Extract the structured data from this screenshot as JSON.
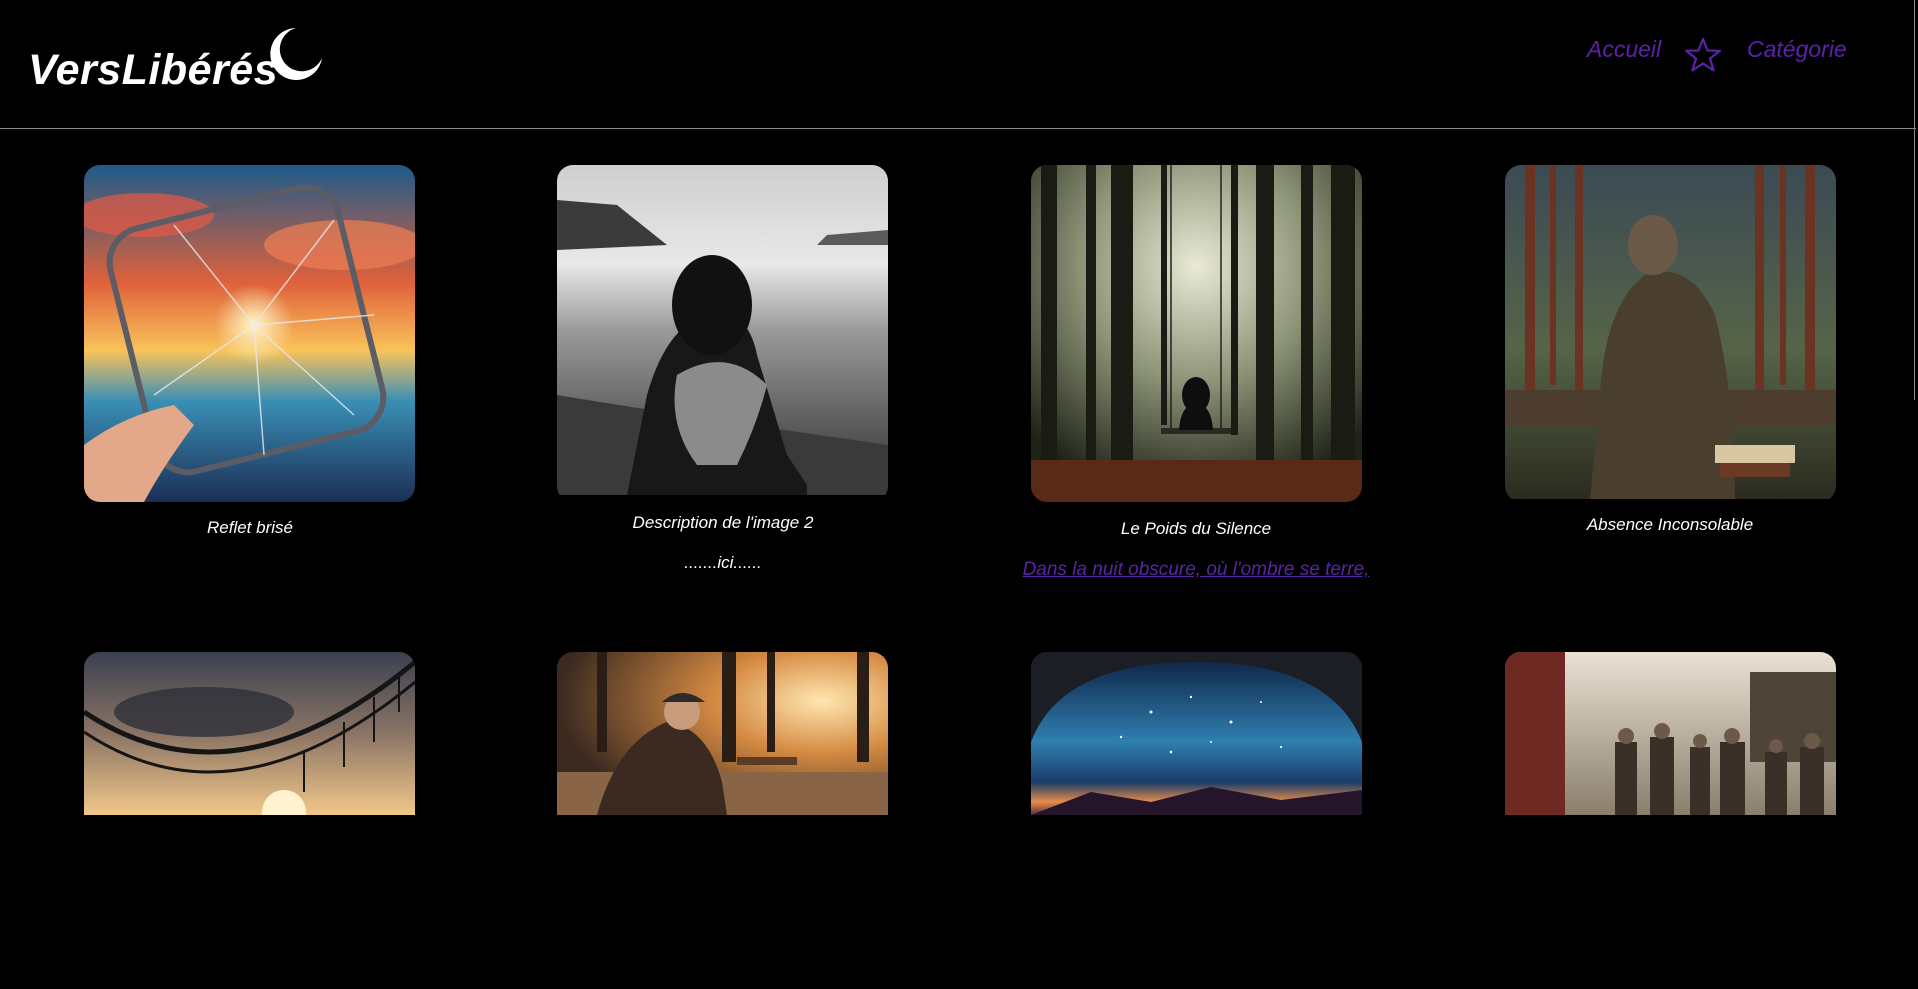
{
  "brand": {
    "name": "VersLibérés",
    "icon": "crescent-moon-icon"
  },
  "nav": {
    "home_label": "Accueil",
    "category_label": "Catégorie",
    "separator_icon": "star-icon",
    "link_color": "#5b23a8"
  },
  "gallery": {
    "row1": [
      {
        "caption": "Reflet brisé",
        "image": "broken mirror reflecting a sunset over the sea"
      },
      {
        "caption": "Description de l'image 2",
        "extra": ".......ici......",
        "image": "black and white photo of a woman hugging her knees by the sea"
      },
      {
        "caption": "Le Poids du Silence",
        "link": "Dans la nuit obscure, où l'ombre se terre,",
        "image": "silhouette on a swing in a misty forest"
      },
      {
        "caption": "Absence Inconsolable",
        "image": "person reading a book on a log in a pine forest"
      }
    ],
    "row2": [
      {
        "image": "suspension bridge under a dramatic sunset sky"
      },
      {
        "image": "old man sitting on a park bench at sunset"
      },
      {
        "image": "starry night sky seen through an arch"
      },
      {
        "image": "crowded old market street"
      }
    ]
  }
}
